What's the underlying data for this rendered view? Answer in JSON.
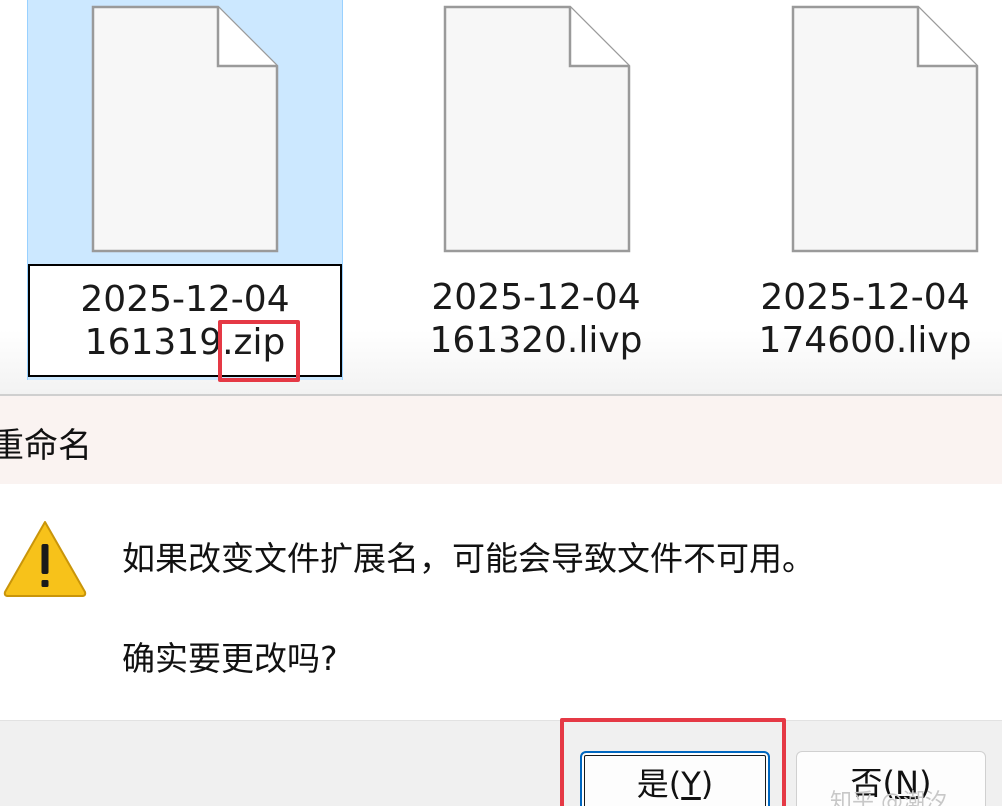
{
  "explorer": {
    "files": [
      {
        "name_line1": "2025-12-04",
        "name_line2_stem": "161319",
        "name_line2_ext": ".zip",
        "selected": true,
        "renaming": true
      },
      {
        "name_line1": "2025-12-04",
        "name_line2": "161320.livp",
        "selected": false
      },
      {
        "name_line1": "2025-12-04",
        "name_line2": "174600.livp",
        "selected": false
      }
    ]
  },
  "dialog": {
    "title": "重命名",
    "icon": "warning-icon",
    "message": "如果改变文件扩展名，可能会导致文件不可用。",
    "question": "确实要更改吗?",
    "buttons": {
      "yes": {
        "label": "是(",
        "mnemonic": "Y",
        "suffix": ")"
      },
      "no": {
        "label": "否(",
        "mnemonic": "N",
        "suffix": ")"
      }
    }
  },
  "watermark": "知乎 @潮汐",
  "colors": {
    "selection_bg": "#cce8ff",
    "highlight_red": "#e53945",
    "warning_yellow": "#f7c21a",
    "dialog_title_bg": "#faf3f1",
    "focus_blue": "#0067c0"
  }
}
